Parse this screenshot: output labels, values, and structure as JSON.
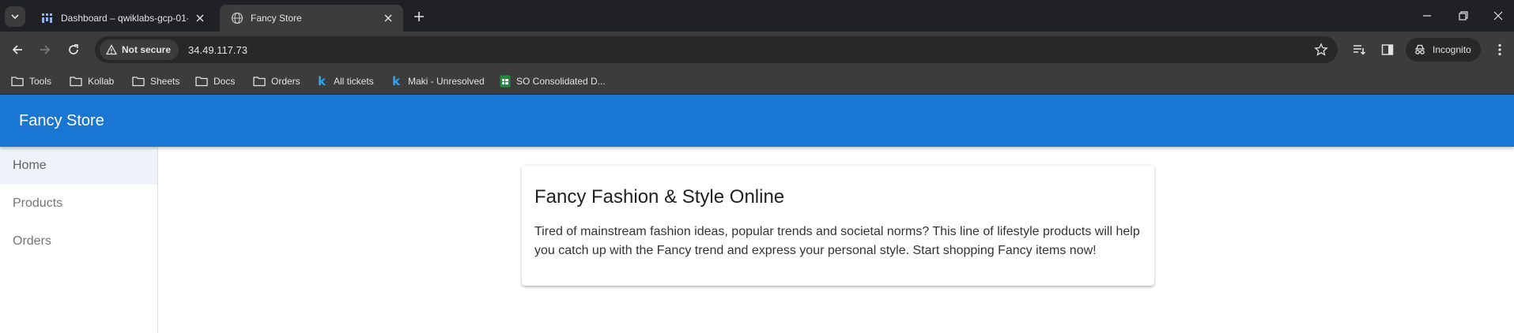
{
  "browser": {
    "tabs": [
      {
        "title": "Dashboard – qwiklabs-gcp-01-",
        "active": false
      },
      {
        "title": "Fancy Store",
        "active": true
      }
    ],
    "security_label": "Not secure",
    "url": "34.49.117.73",
    "profile_label": "Incognito",
    "bookmarks": [
      {
        "label": "Tools",
        "icon": "folder-icon"
      },
      {
        "label": "Kollab",
        "icon": "folder-icon"
      },
      {
        "label": "Sheets",
        "icon": "folder-icon"
      },
      {
        "label": "Docs",
        "icon": "folder-icon"
      },
      {
        "label": "Orders",
        "icon": "folder-icon"
      },
      {
        "label": "All tickets",
        "icon": "k-icon"
      },
      {
        "label": "Maki - Unresolved",
        "icon": "k-icon"
      },
      {
        "label": "SO Consolidated D...",
        "icon": "sheets-icon"
      }
    ],
    "k_glyph": "k"
  },
  "app": {
    "title": "Fancy Store",
    "nav": [
      {
        "label": "Home",
        "active": true
      },
      {
        "label": "Products",
        "active": false
      },
      {
        "label": "Orders",
        "active": false
      }
    ],
    "card": {
      "title": "Fancy Fashion & Style Online",
      "body": "Tired of mainstream fashion ideas, popular trends and societal norms? This line of lifestyle products will help you catch up with the Fancy trend and express your personal style. Start shopping Fancy items now!"
    }
  },
  "colors": {
    "appbar": "#1976d2",
    "chrome_dark": "#202124",
    "chrome_toolbar": "#3c3c3c",
    "active_nav_bg": "#eef3fb"
  }
}
